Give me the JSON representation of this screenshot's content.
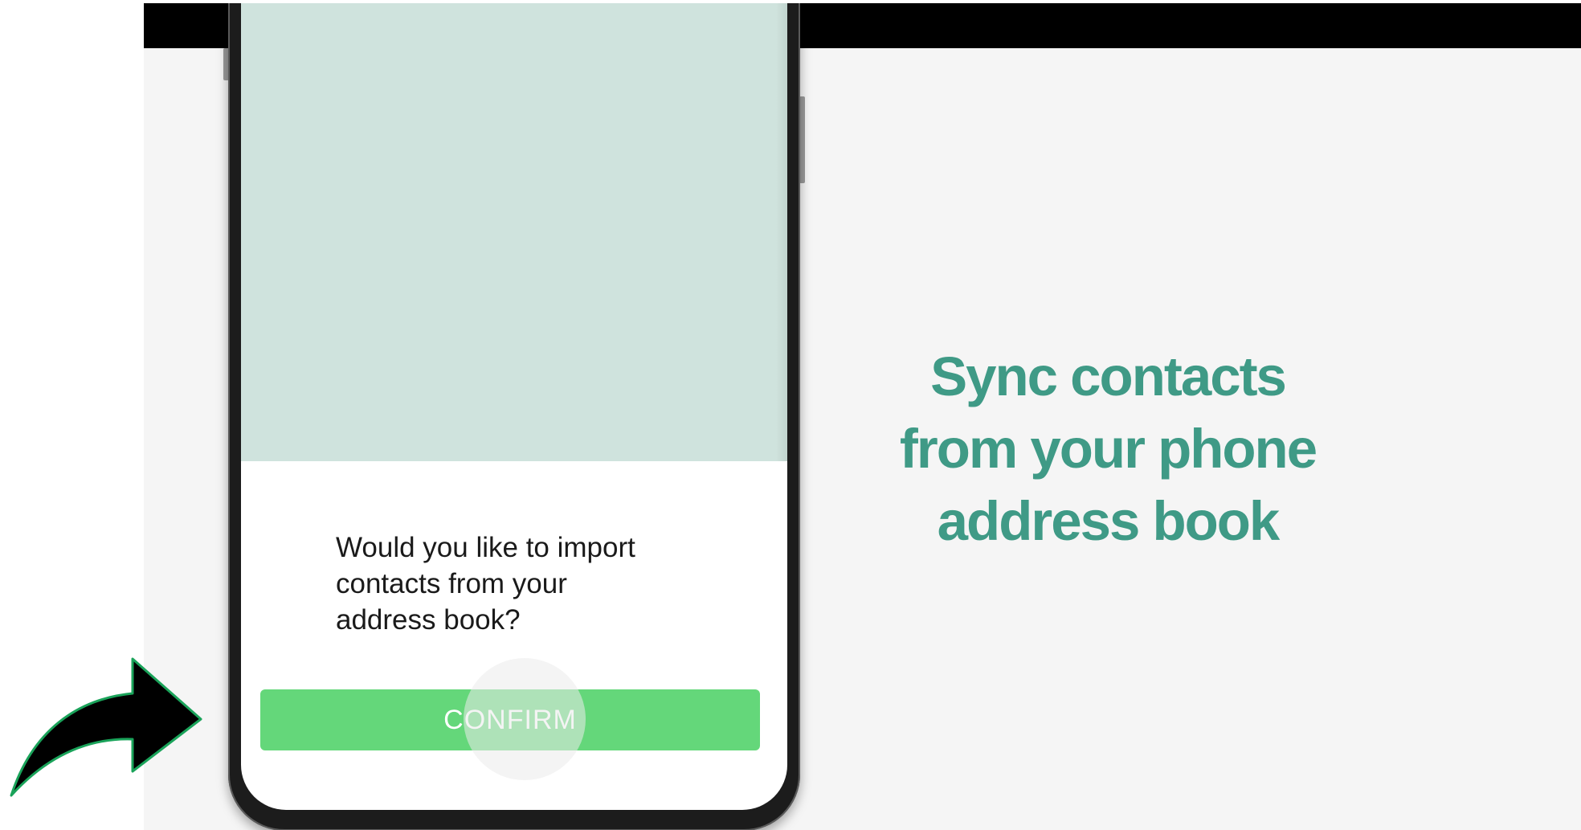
{
  "dialog": {
    "message": "Would you like to import\ncontacts from your\naddress book?",
    "confirm_label": "CONFIRM"
  },
  "headline": {
    "line1": "Sync contacts",
    "line2": "from your phone",
    "line3": "address book"
  },
  "colors": {
    "accent_green": "#64d77a",
    "headline_teal": "#3f9a86",
    "screen_mint": "#cfe3dd",
    "background": "#f5f5f5"
  },
  "icons": {
    "pointer": "curved-arrow-icon"
  }
}
